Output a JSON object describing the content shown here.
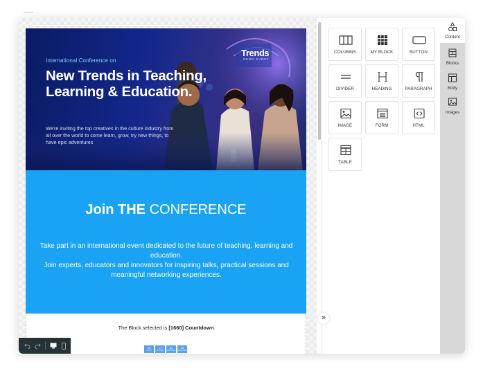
{
  "hero": {
    "eyebrow": "International Conference on",
    "title": "New Trends in Teaching, Learning & Education.",
    "text": "We're inviting the top creatives in the culture industry from all over the world to come learn, grow, try new things, to have epic adventures",
    "sign_title": "Trends",
    "sign_subtitle": "DEMO EVENT"
  },
  "conference": {
    "title_bold": "Join THE",
    "title_light": "CONFERENCE",
    "text": "Take part in an international event dedicated to the future of teaching, learning and education.\nJoin experts, educators and innovators for inspiring talks, practical sessions and meaningful networking experiences."
  },
  "countdown": {
    "text_prefix": "The Block selected is ",
    "text_bold": "[1660] Countdown",
    "text_suffix": ".",
    "boxes": [
      {
        "value": "16",
        "label": "DAYS"
      },
      {
        "value": "17",
        "label": "HOURS"
      },
      {
        "value": "53",
        "label": "MINUTES"
      },
      {
        "value": "40",
        "label": "SECONDS"
      }
    ]
  },
  "tools": [
    {
      "label": "COLUMNS",
      "icon": "columns-icon"
    },
    {
      "label": "MY BLOCK",
      "icon": "grid-icon"
    },
    {
      "label": "BUTTON",
      "icon": "button-icon"
    },
    {
      "label": "DIVIDER",
      "icon": "divider-icon"
    },
    {
      "label": "HEADING",
      "icon": "heading-icon"
    },
    {
      "label": "PARAGRAPH",
      "icon": "paragraph-icon"
    },
    {
      "label": "IMAGE",
      "icon": "image-icon"
    },
    {
      "label": "FORM",
      "icon": "form-icon"
    },
    {
      "label": "HTML",
      "icon": "code-icon"
    },
    {
      "label": "TABLE",
      "icon": "table-icon"
    }
  ],
  "tabs": [
    {
      "label": "Content",
      "icon": "shapes-icon",
      "active": true
    },
    {
      "label": "Blocks",
      "icon": "blocks-icon",
      "active": false
    },
    {
      "label": "Body",
      "icon": "body-icon",
      "active": false
    },
    {
      "label": "Images",
      "icon": "images-icon",
      "active": false
    }
  ],
  "colors": {
    "accent_blue": "#1aa3f4",
    "hero_navy": "#0b1b63",
    "toolbar_dark": "#263238"
  }
}
